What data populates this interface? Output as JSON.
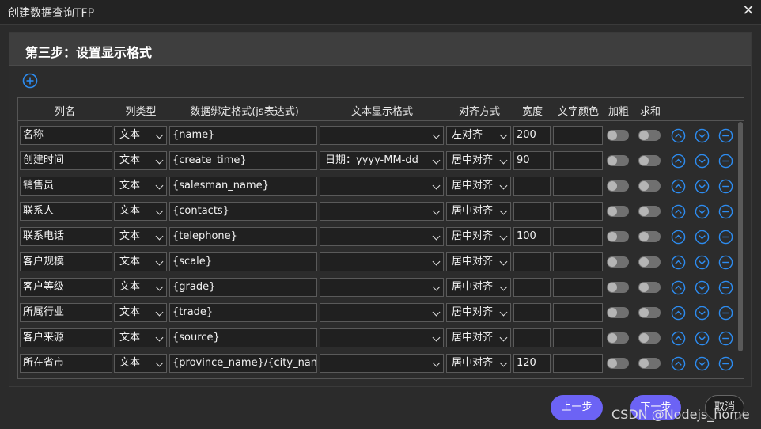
{
  "window": {
    "title": "创建数据查询TFP"
  },
  "step": {
    "title": "第三步：设置显示格式"
  },
  "columns": [
    "列名",
    "列类型",
    "数据绑定格式(js表达式)",
    "文本显示格式",
    "对齐方式",
    "宽度",
    "文字颜色",
    "加粗",
    "求和"
  ],
  "rows": [
    {
      "name": "名称",
      "type": "文本",
      "bind": "{name}",
      "format": "",
      "align": "左对齐",
      "width": "200",
      "color": ""
    },
    {
      "name": "创建时间",
      "type": "文本",
      "bind": "{create_time}",
      "format": "日期：yyyy-MM-dd",
      "align": "居中对齐",
      "width": "90",
      "color": ""
    },
    {
      "name": "销售员",
      "type": "文本",
      "bind": "{salesman_name}",
      "format": "",
      "align": "居中对齐",
      "width": "",
      "color": ""
    },
    {
      "name": "联系人",
      "type": "文本",
      "bind": "{contacts}",
      "format": "",
      "align": "居中对齐",
      "width": "",
      "color": ""
    },
    {
      "name": "联系电话",
      "type": "文本",
      "bind": "{telephone}",
      "format": "",
      "align": "居中对齐",
      "width": "100",
      "color": ""
    },
    {
      "name": "客户规模",
      "type": "文本",
      "bind": "{scale}",
      "format": "",
      "align": "居中对齐",
      "width": "",
      "color": ""
    },
    {
      "name": "客户等级",
      "type": "文本",
      "bind": "{grade}",
      "format": "",
      "align": "居中对齐",
      "width": "",
      "color": ""
    },
    {
      "name": "所属行业",
      "type": "文本",
      "bind": "{trade}",
      "format": "",
      "align": "居中对齐",
      "width": "",
      "color": ""
    },
    {
      "name": "客户来源",
      "type": "文本",
      "bind": "{source}",
      "format": "",
      "align": "居中对齐",
      "width": "",
      "color": ""
    },
    {
      "name": "所在省市",
      "type": "文本",
      "bind": "{province_name}/{city_name",
      "format": "",
      "align": "居中对齐",
      "width": "120",
      "color": ""
    }
  ],
  "buttons": {
    "prev": "上一步",
    "next": "下一步",
    "cancel": "取消"
  },
  "watermark": "CSDN @Nodejs_home",
  "colors": {
    "accent": "#6c63f5",
    "icon_blue": "#2d8cf0"
  },
  "icons": {
    "add": "plus-circle-icon",
    "up": "arrow-up-circle-icon",
    "down": "arrow-down-circle-icon",
    "remove": "minus-circle-icon",
    "close": "close-icon"
  }
}
